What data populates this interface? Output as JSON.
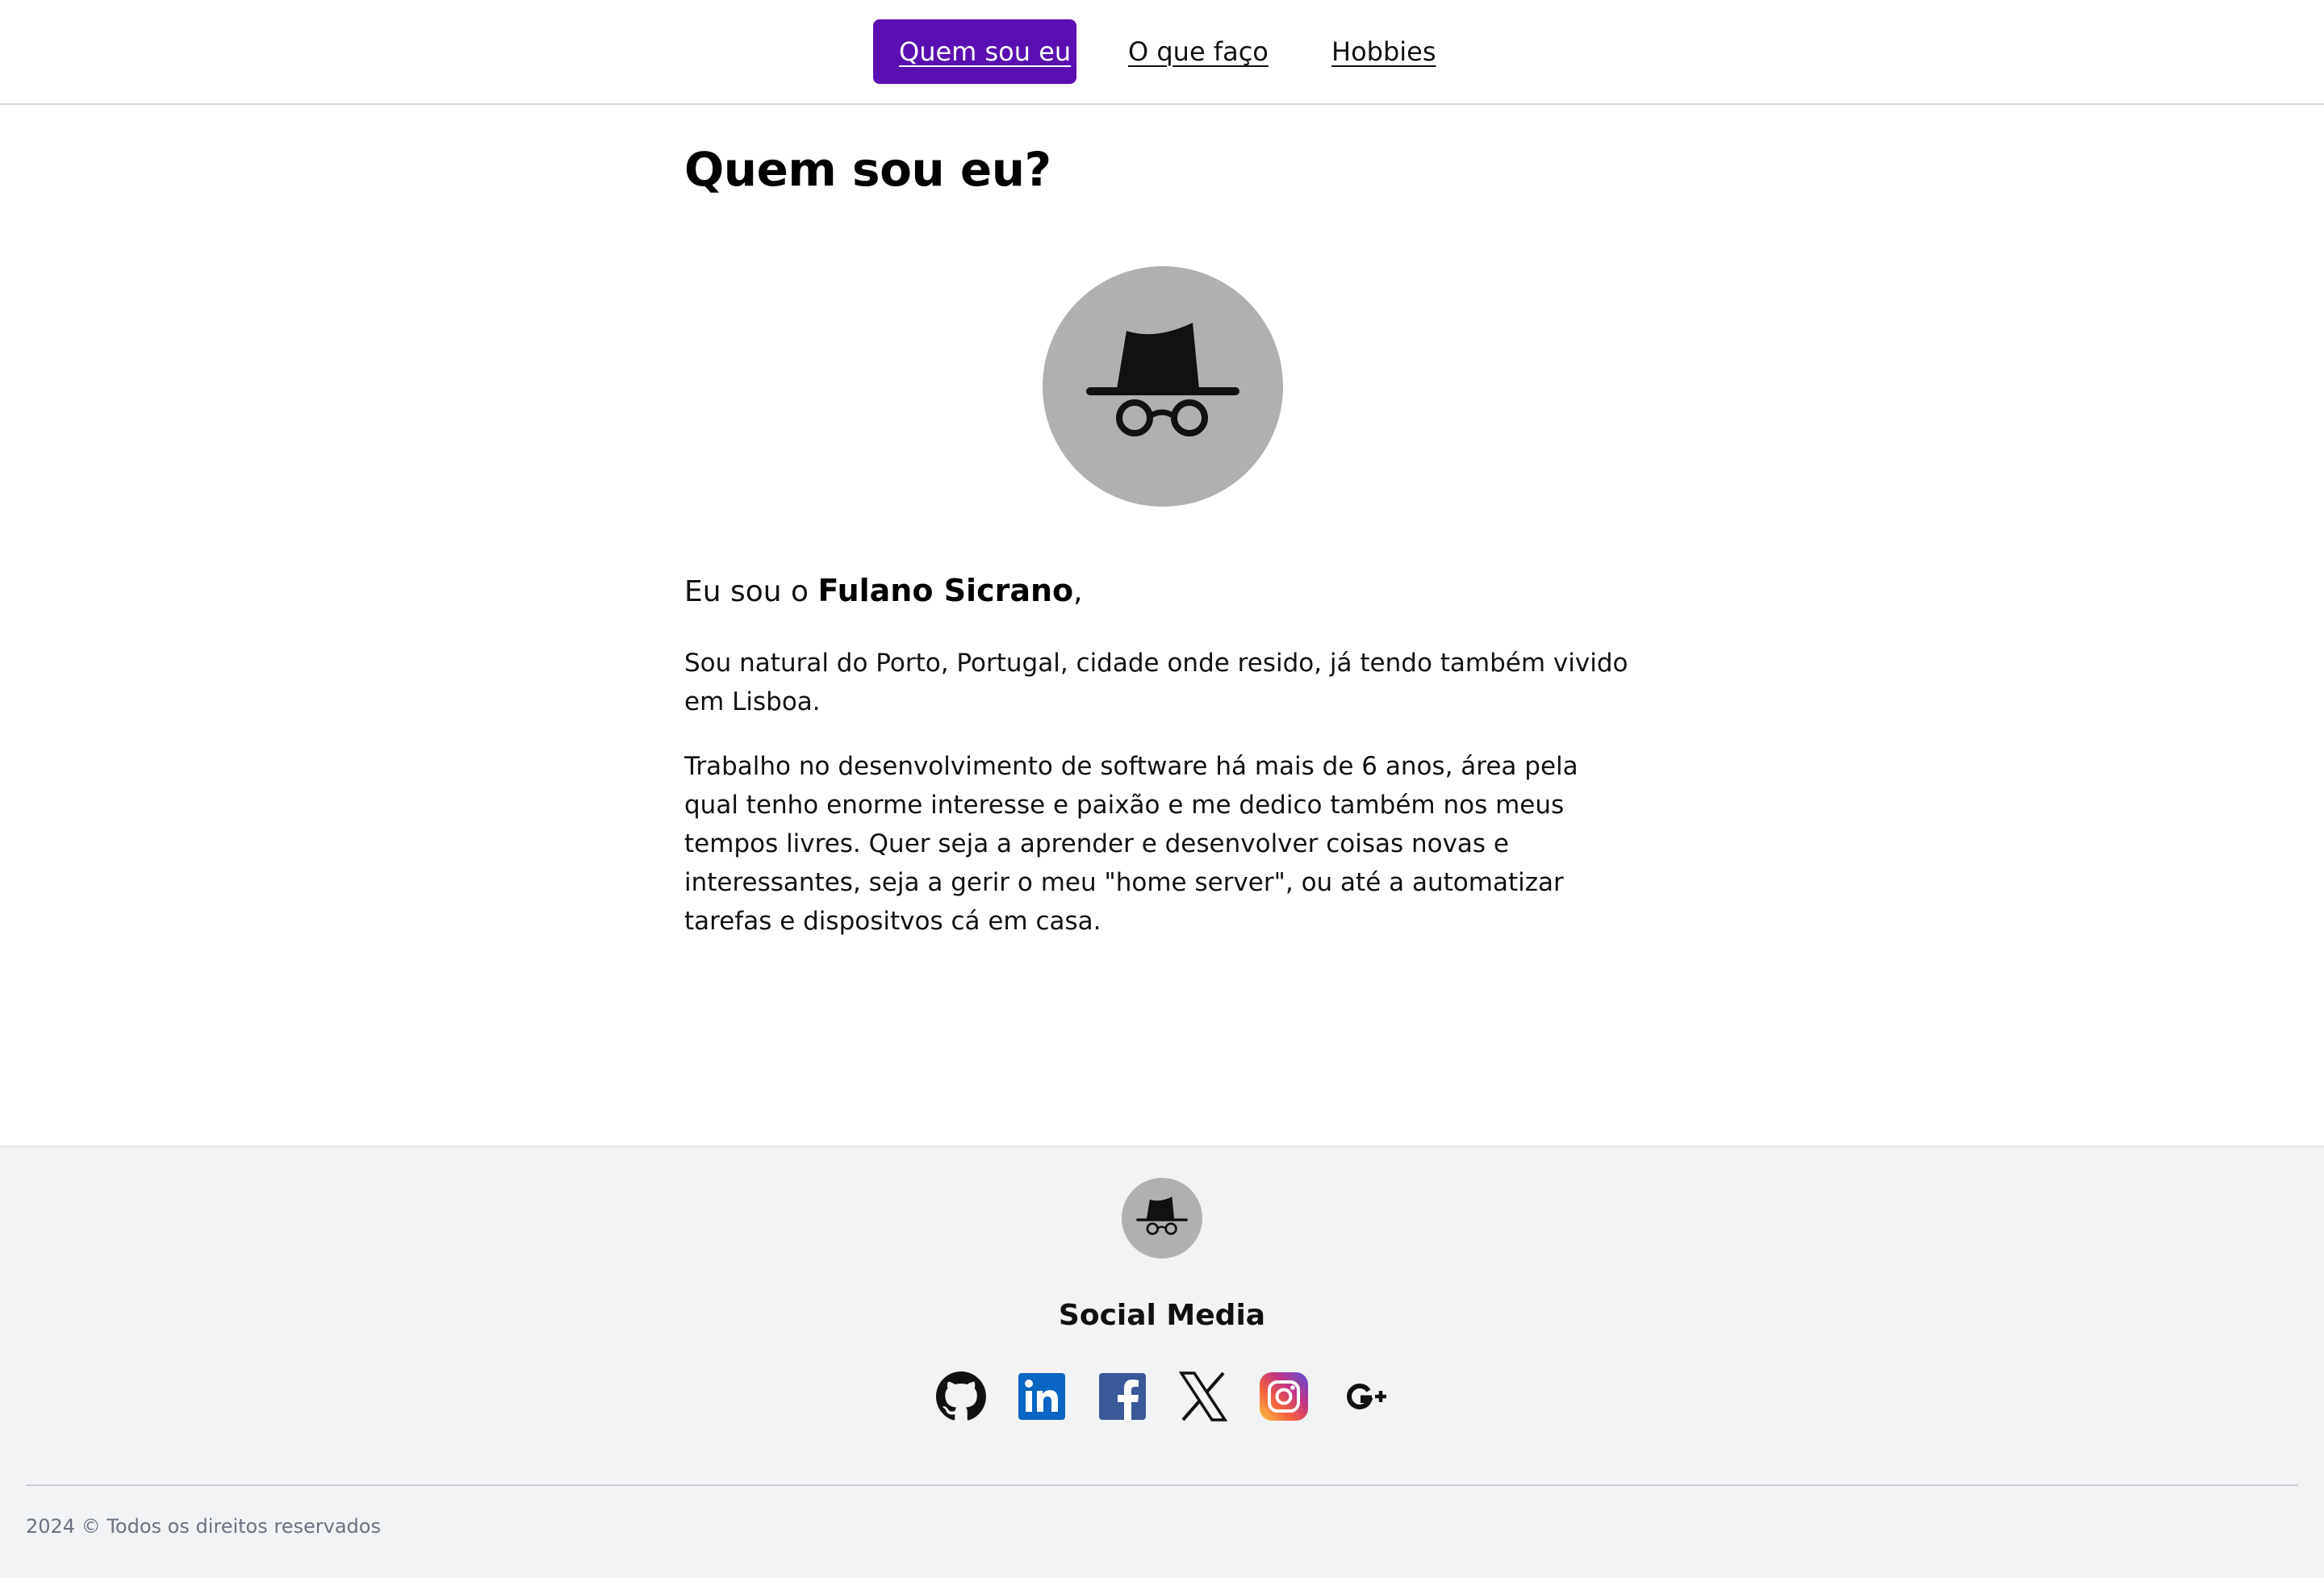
{
  "nav": {
    "items": [
      {
        "label": "Quem sou eu",
        "active": true
      },
      {
        "label": "O que faço",
        "active": false
      },
      {
        "label": "Hobbies",
        "active": false
      }
    ]
  },
  "main": {
    "title": "Quem sou eu?",
    "avatar_icon": "incognito-icon",
    "intro_prefix": "Eu sou o ",
    "intro_name": "Fulano Sicrano",
    "intro_suffix": ",",
    "paragraphs": [
      "Sou natural do Porto, Portugal, cidade onde resido, já tendo também vivido em Lisboa.",
      "Trabalho no desenvolvimento de software há mais de 6 anos, área pela qual tenho enorme interesse e paixão e me dedico também nos meus tempos livres. Quer seja a aprender e desenvolver coisas novas e interessantes, seja a gerir o meu \"home server\", ou até a automatizar tarefas e dispositvos cá em casa."
    ]
  },
  "footer": {
    "logo_icon": "incognito-icon",
    "social_title": "Social Media",
    "social_links": [
      {
        "icon": "github-icon"
      },
      {
        "icon": "linkedin-icon"
      },
      {
        "icon": "facebook-icon"
      },
      {
        "icon": "x-icon"
      },
      {
        "icon": "instagram-icon"
      },
      {
        "icon": "google-plus-icon"
      }
    ],
    "copyright": "2024 © Todos os direitos reservados"
  },
  "colors": {
    "accent": "#5b0fb0",
    "avatar_bg": "#b0b0b0",
    "footer_bg": "#f2f3f5",
    "linkedin": "#0a66c2",
    "facebook": "#3b5998"
  }
}
